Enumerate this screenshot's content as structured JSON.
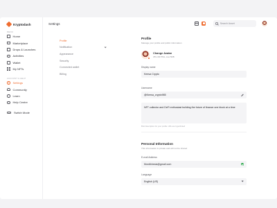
{
  "brand": {
    "name": "Kryptodash"
  },
  "sidebar": {
    "menu_label": "MENU",
    "account_label": "ACCOUNT & HELP",
    "menu_items": [
      {
        "label": "Home",
        "icon": "home-icon"
      },
      {
        "label": "Marketplace",
        "icon": "marketplace-icon"
      },
      {
        "label": "Drops & Launches",
        "icon": "drops-icon"
      },
      {
        "label": "Activities",
        "icon": "activities-icon"
      },
      {
        "label": "Wallet",
        "icon": "wallet-icon"
      },
      {
        "label": "My NFTs",
        "icon": "nfts-icon"
      }
    ],
    "account_items": [
      {
        "label": "Settings",
        "icon": "gear-icon",
        "active": true
      },
      {
        "label": "Community",
        "icon": "community-icon"
      },
      {
        "label": "Learn",
        "icon": "learn-icon"
      },
      {
        "label": "Help Centre",
        "icon": "help-icon"
      }
    ],
    "switch_mode": "Switch Mode"
  },
  "header": {
    "title": "Settings",
    "search_placeholder": "Search Asset"
  },
  "settings_menu": {
    "items": [
      {
        "label": "Profile",
        "active": true
      },
      {
        "label": "Notification",
        "expandable": true
      },
      {
        "label": "Appearance"
      },
      {
        "label": "Security"
      },
      {
        "label": "Connected wallet"
      },
      {
        "label": "Billing"
      }
    ]
  },
  "profile": {
    "heading": "Profile",
    "subheading": "Manage your profile and public information",
    "change_avatar": "Change Avatar",
    "avatar_hint": "JPG OR PNG, max 5MB",
    "display_name_label": "Display name",
    "display_name_value": "Keesa Crypto",
    "username_label": "Username",
    "username_value": "@Keesa_crypto985",
    "bio_value": "NFT collector and DeFi enthusiast building the future of finance one block at a time",
    "bio_hint": "Brief description for your profile. URL are hyperlinked"
  },
  "personal": {
    "heading": "Personal Information",
    "subheading": "This information is private and will not be shared",
    "email_label": "E-mail Address",
    "email_value": "Mordikhesia@gmail.com",
    "language_label": "Language",
    "language_value": "English (US)"
  },
  "colors": {
    "accent": "#ef6c2f",
    "success": "#27a547",
    "field_bg": "#f4f4f6"
  }
}
